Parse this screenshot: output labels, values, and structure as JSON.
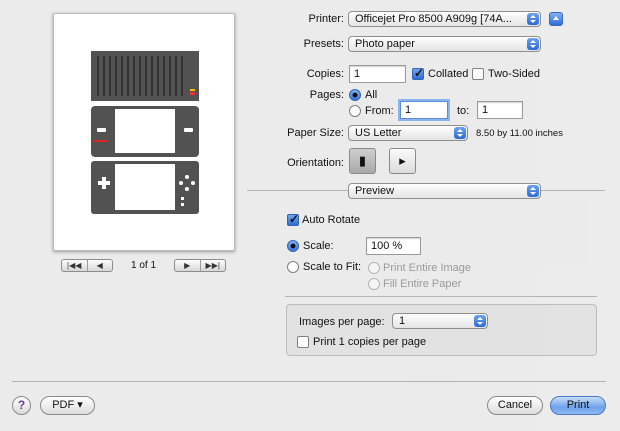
{
  "printer": {
    "label": "Printer:",
    "value": "Officejet Pro 8500 A909g [74A..."
  },
  "presets": {
    "label": "Presets:",
    "value": "Photo paper"
  },
  "copies": {
    "label": "Copies:",
    "value": "1",
    "collated_label": "Collated",
    "collated": true,
    "two_sided_label": "Two-Sided",
    "two_sided": false
  },
  "pages": {
    "label": "Pages:",
    "all_label": "All",
    "from_label": "From:",
    "from_value": "1",
    "to_label": "to:",
    "to_value": "1",
    "selected": "All"
  },
  "paper_size": {
    "label": "Paper Size:",
    "value": "US Letter",
    "dimensions": "8.50 by 11.00 inches"
  },
  "orientation": {
    "label": "Orientation:",
    "selected": "portrait"
  },
  "section_menu": {
    "value": "Preview"
  },
  "preview_options": {
    "auto_rotate_label": "Auto Rotate",
    "auto_rotate": true,
    "scale_label": "Scale:",
    "scale_value": "100 %",
    "scale_to_fit_label": "Scale to Fit:",
    "print_entire_image_label": "Print Entire Image",
    "fill_entire_paper_label": "Fill Entire Paper",
    "selected": "Scale"
  },
  "images_per_page": {
    "label": "Images per page:",
    "value": "1",
    "copies_per_page_label": "Print 1 copies per page",
    "copies_per_page": false
  },
  "pager": {
    "text": "1 of 1"
  },
  "footer": {
    "help_label": "?",
    "pdf_label": "PDF ▾",
    "cancel_label": "Cancel",
    "print_label": "Print"
  },
  "colors": {
    "accent": "#3c78da",
    "skin_gray": "#525252",
    "sheet_bg": "#ececec"
  }
}
